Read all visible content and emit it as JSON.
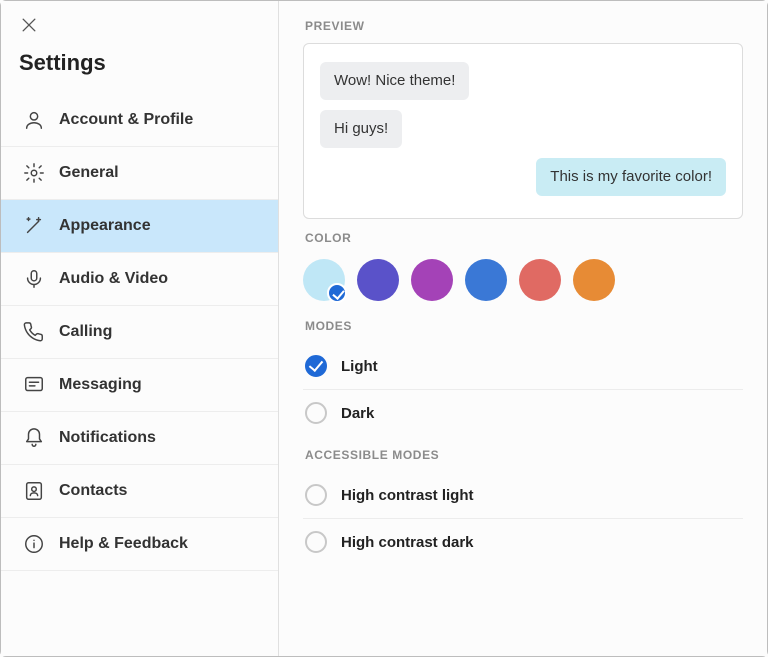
{
  "sidebar": {
    "title": "Settings",
    "items": [
      {
        "key": "account",
        "label": "Account & Profile",
        "icon": "person-icon"
      },
      {
        "key": "general",
        "label": "General",
        "icon": "gear-icon"
      },
      {
        "key": "appearance",
        "label": "Appearance",
        "icon": "wand-icon"
      },
      {
        "key": "audiovideo",
        "label": "Audio & Video",
        "icon": "microphone-icon"
      },
      {
        "key": "calling",
        "label": "Calling",
        "icon": "phone-icon"
      },
      {
        "key": "messaging",
        "label": "Messaging",
        "icon": "message-icon"
      },
      {
        "key": "notifications",
        "label": "Notifications",
        "icon": "bell-icon"
      },
      {
        "key": "contacts",
        "label": "Contacts",
        "icon": "contacts-icon"
      },
      {
        "key": "help",
        "label": "Help & Feedback",
        "icon": "info-icon"
      }
    ],
    "selected": "appearance"
  },
  "sections": {
    "preview": "PREVIEW",
    "color": "COLOR",
    "modes": "MODES",
    "accessible": "ACCESSIBLE MODES"
  },
  "preview": {
    "messages": [
      {
        "text": "Wow! Nice theme!",
        "direction": "incoming"
      },
      {
        "text": "Hi guys!",
        "direction": "incoming"
      },
      {
        "text": "This is my favorite color!",
        "direction": "outgoing"
      }
    ],
    "outgoing_bg": "#c9ecf4"
  },
  "colors": [
    {
      "hex": "#bfe7f6",
      "selected": true
    },
    {
      "hex": "#5a52c9",
      "selected": false
    },
    {
      "hex": "#a442b7",
      "selected": false
    },
    {
      "hex": "#3a78d6",
      "selected": false
    },
    {
      "hex": "#e06a63",
      "selected": false
    },
    {
      "hex": "#e78b35",
      "selected": false
    }
  ],
  "modes": [
    {
      "label": "Light",
      "selected": true
    },
    {
      "label": "Dark",
      "selected": false
    }
  ],
  "accessible_modes": [
    {
      "label": "High contrast light",
      "selected": false
    },
    {
      "label": "High contrast dark",
      "selected": false
    }
  ]
}
